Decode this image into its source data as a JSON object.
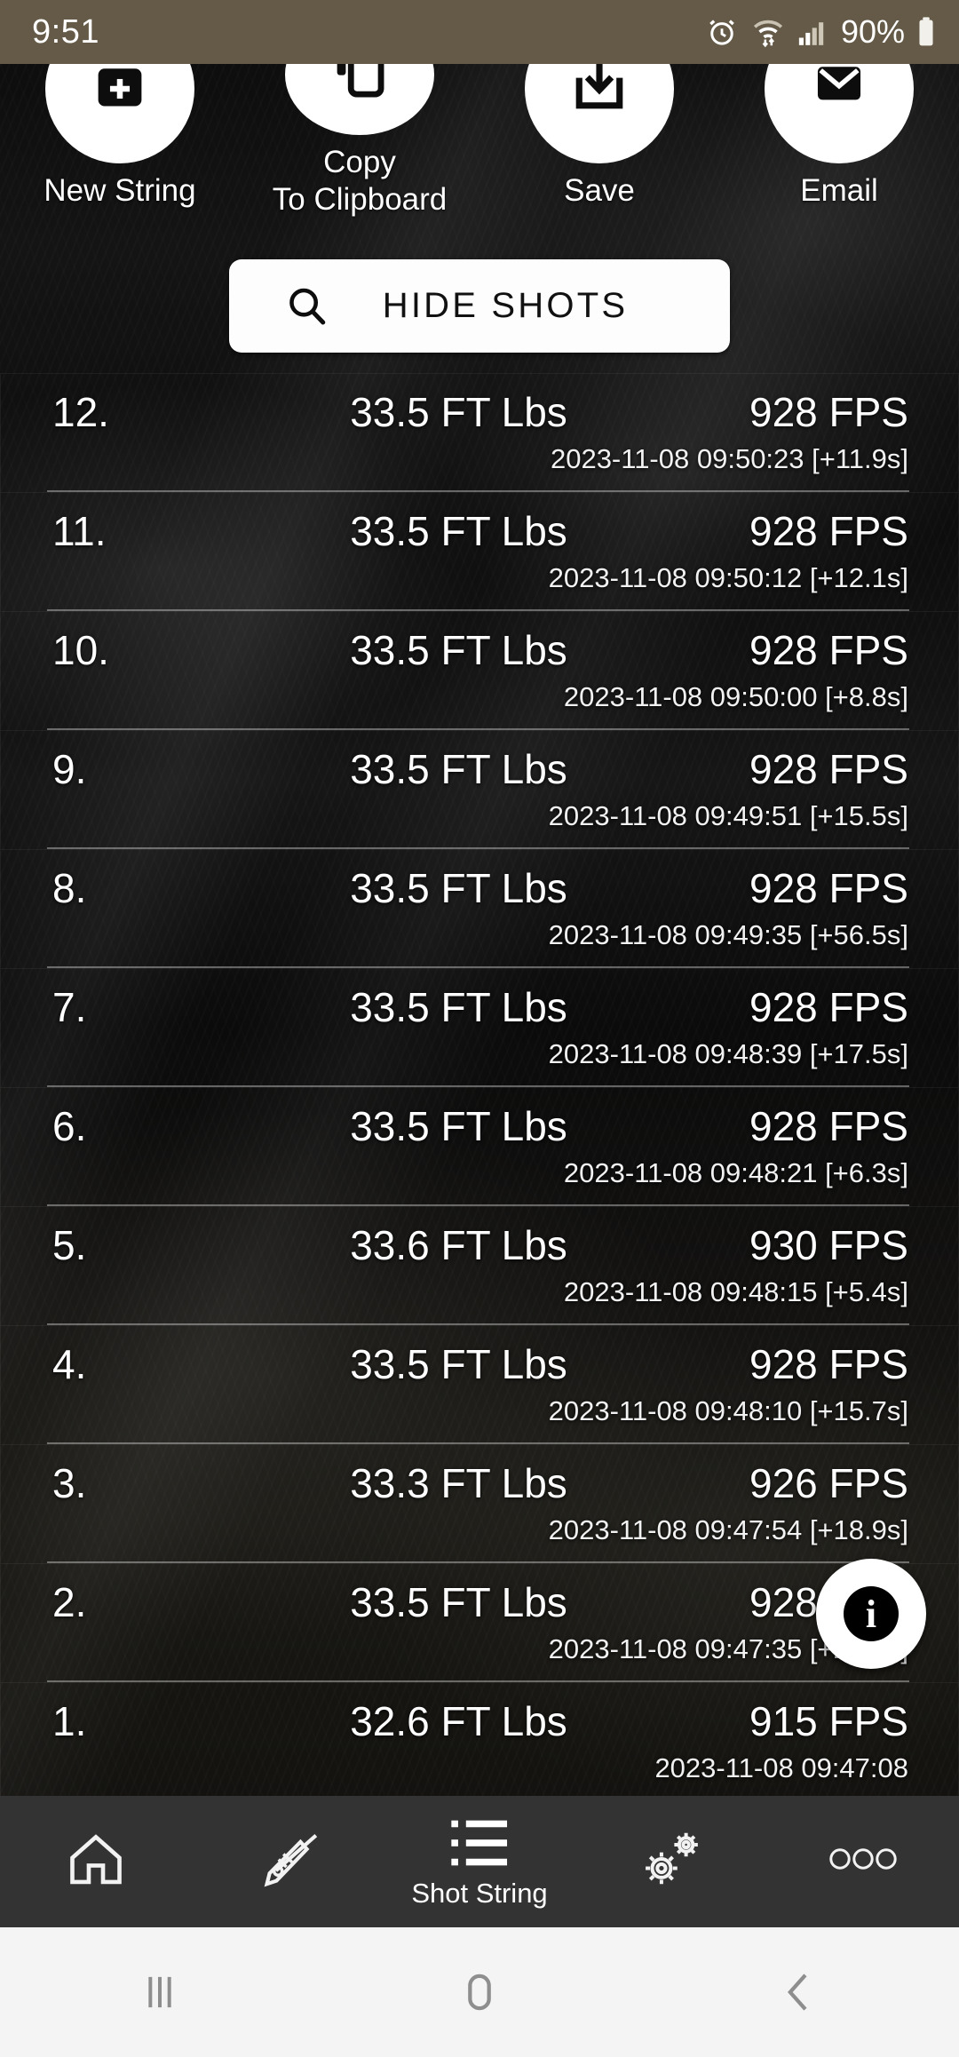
{
  "status_bar": {
    "time": "9:51",
    "battery_percent": "90%",
    "icons": [
      "alarm-icon",
      "wifi-icon",
      "cellular-signal-icon",
      "battery-icon"
    ],
    "background_color": "#645a47"
  },
  "actions": [
    {
      "label": "New String",
      "icon": "new-string-icon"
    },
    {
      "label": "Copy\nTo Clipboard",
      "label_line1": "Copy",
      "label_line2": "To Clipboard",
      "icon": "copy-icon"
    },
    {
      "label": "Save",
      "icon": "save-download-icon"
    },
    {
      "label": "Email",
      "icon": "email-icon"
    }
  ],
  "hide_shots_button": {
    "label": "HIDE SHOTS",
    "icon": "search-icon",
    "background_color": "#fdfdfd",
    "text_color": "#111111"
  },
  "shot_list": {
    "columns": [
      "index",
      "energy",
      "speed",
      "timestamp"
    ],
    "rows": [
      {
        "index": "12.",
        "energy": "33.5 FT Lbs",
        "speed": "928 FPS",
        "timestamp": "2023-11-08 09:50:23 [+11.9s]"
      },
      {
        "index": "11.",
        "energy": "33.5 FT Lbs",
        "speed": "928 FPS",
        "timestamp": "2023-11-08 09:50:12 [+12.1s]"
      },
      {
        "index": "10.",
        "energy": "33.5 FT Lbs",
        "speed": "928 FPS",
        "timestamp": "2023-11-08 09:50:00 [+8.8s]"
      },
      {
        "index": "9.",
        "energy": "33.5 FT Lbs",
        "speed": "928 FPS",
        "timestamp": "2023-11-08 09:49:51 [+15.5s]"
      },
      {
        "index": "8.",
        "energy": "33.5 FT Lbs",
        "speed": "928 FPS",
        "timestamp": "2023-11-08 09:49:35 [+56.5s]"
      },
      {
        "index": "7.",
        "energy": "33.5 FT Lbs",
        "speed": "928 FPS",
        "timestamp": "2023-11-08 09:48:39 [+17.5s]"
      },
      {
        "index": "6.",
        "energy": "33.5 FT Lbs",
        "speed": "928 FPS",
        "timestamp": "2023-11-08 09:48:21 [+6.3s]"
      },
      {
        "index": "5.",
        "energy": "33.6 FT Lbs",
        "speed": "930 FPS",
        "timestamp": "2023-11-08 09:48:15 [+5.4s]"
      },
      {
        "index": "4.",
        "energy": "33.5 FT Lbs",
        "speed": "928 FPS",
        "timestamp": "2023-11-08 09:48:10 [+15.7s]"
      },
      {
        "index": "3.",
        "energy": "33.3 FT Lbs",
        "speed": "926 FPS",
        "timestamp": "2023-11-08 09:47:54 [+18.9s]"
      },
      {
        "index": "2.",
        "energy": "33.5 FT Lbs",
        "speed": "928 FPS",
        "timestamp": "2023-11-08 09:47:35 [+26.9s]"
      },
      {
        "index": "1.",
        "energy": "32.6 FT Lbs",
        "speed": "915 FPS",
        "timestamp": "2023-11-08 09:47:08"
      }
    ]
  },
  "info_fab": {
    "icon": "info-icon",
    "glyph": "i"
  },
  "bottom_nav": {
    "background_color": "#333333",
    "items": [
      {
        "label": "",
        "icon": "home-icon",
        "active": false
      },
      {
        "label": "",
        "icon": "rifle-icon",
        "active": false
      },
      {
        "label": "Shot String",
        "icon": "list-icon",
        "active": true
      },
      {
        "label": "",
        "icon": "gears-icon",
        "active": false
      },
      {
        "label": "",
        "icon": "more-dots-icon",
        "active": false
      }
    ]
  },
  "system_nav": {
    "background_color": "#f4f4f4",
    "items": [
      {
        "icon": "recents-icon"
      },
      {
        "icon": "home-pill-icon"
      },
      {
        "icon": "back-chevron-icon"
      }
    ]
  }
}
